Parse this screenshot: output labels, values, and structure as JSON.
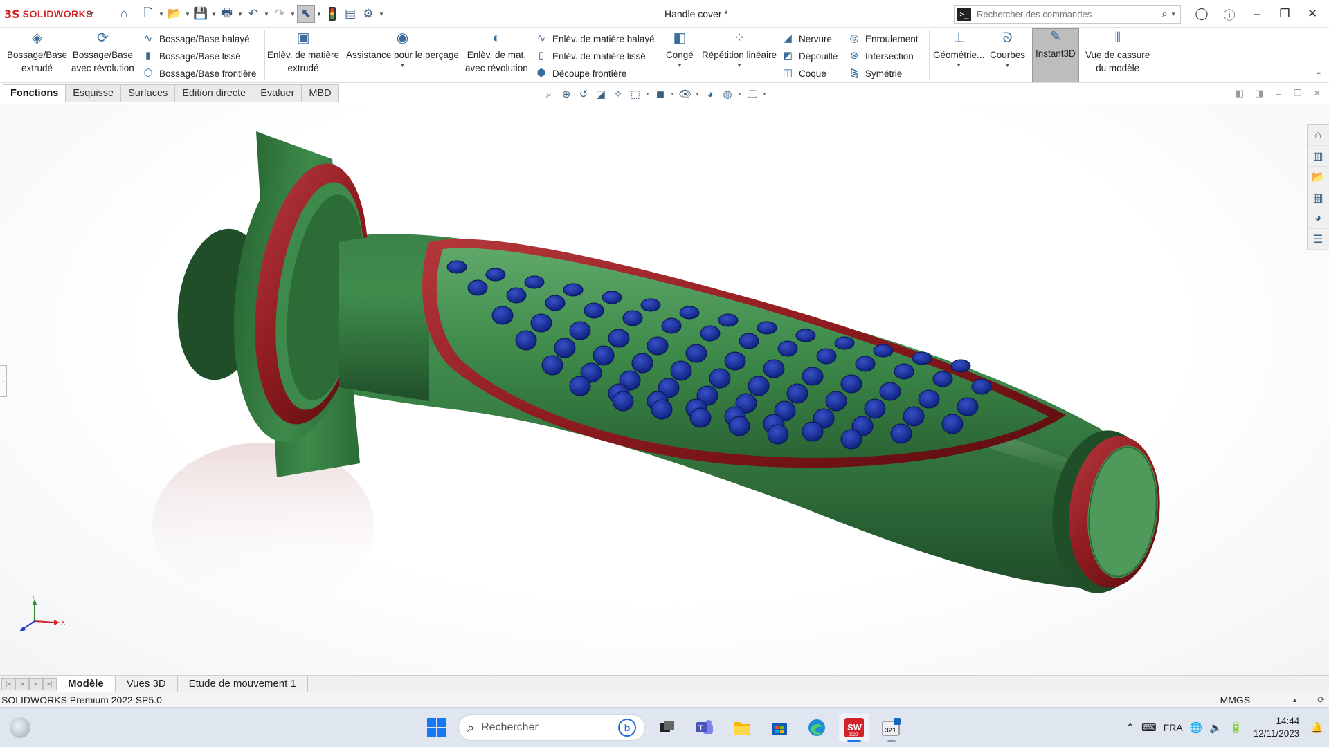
{
  "app": {
    "brand_prefix": "3S",
    "brand_name": "SOLIDWORKS",
    "document_title": "Handle cover *"
  },
  "search": {
    "placeholder": "Rechercher des commandes"
  },
  "ribbon": {
    "extrude_boss": [
      "Bossage/Base",
      "extrudé"
    ],
    "revolve_boss": [
      "Bossage/Base",
      "avec révolution"
    ],
    "swept_boss": "Bossage/Base balayé",
    "loft_boss": "Bossage/Base lissé",
    "boundary_boss": "Bossage/Base frontière",
    "extrude_cut": [
      "Enlèv. de matière",
      "extrudé"
    ],
    "hole_wizard": "Assistance pour le perçage",
    "revolve_cut": [
      "Enlèv. de mat.",
      "avec révolution"
    ],
    "swept_cut": "Enlèv. de matière balayé",
    "loft_cut": "Enlèv. de matière lissé",
    "boundary_cut": "Découpe frontière",
    "fillet": "Congé",
    "linear_pattern": "Répétition linéaire",
    "rib": "Nervure",
    "draft": "Dépouille",
    "shell": "Coque",
    "wrap": "Enroulement",
    "intersect": "Intersection",
    "mirror": "Symétrie",
    "ref_geometry": "Géométrie...",
    "curves": "Courbes",
    "instant3d": "Instant3D",
    "break_view": [
      "Vue de cassure",
      "du modèle"
    ]
  },
  "command_tabs": [
    "Fonctions",
    "Esquisse",
    "Surfaces",
    "Edition directe",
    "Evaluer",
    "MBD"
  ],
  "bottom_tabs": [
    "Modèle",
    "Vues 3D",
    "Etude de mouvement 1"
  ],
  "status": {
    "version": "SOLIDWORKS Premium 2022 SP5.0",
    "units": "MMGS"
  },
  "taskbar": {
    "search_placeholder": "Rechercher",
    "language": "FRA",
    "time": "14:44",
    "date": "12/11/2023",
    "sw_badge": "SW",
    "sw_year": "2022",
    "calc_label": "321"
  },
  "triad": {
    "x": "X",
    "y": "Y"
  },
  "icons": {
    "home": "home-icon",
    "new": "new-document-icon",
    "open": "open-folder-icon",
    "save": "save-icon",
    "print": "print-icon",
    "undo": "undo-icon",
    "redo": "redo-icon",
    "select": "select-cursor-icon",
    "rebuild": "rebuild-traffic-light-icon",
    "file_props": "file-properties-icon",
    "options": "gear-icon"
  },
  "colors": {
    "grip_green": "#3f8a4e",
    "rim_red": "#8e1b1f",
    "dot_blue": "#0f2a8c",
    "accent": "#d2232a"
  }
}
